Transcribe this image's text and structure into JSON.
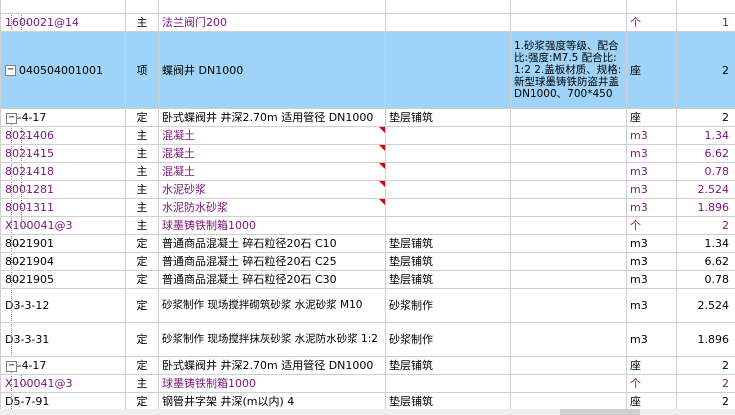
{
  "rows": [
    {
      "code": "1600021@14",
      "type": "主",
      "name": "法兰阀门200",
      "feature": "",
      "unit": "个",
      "qty": "1",
      "kind": "mat"
    },
    {
      "code": "040504001001",
      "type": "项",
      "name": "蝶阀井 DN1000",
      "feature": "1.砂浆强度等级、配合比:强度:M7.5 配合比:1:2 2.盖板材质、规格:新型球墨铸铁防盗井盖DN1000、700*450",
      "unit": "座",
      "qty": "2",
      "kind": "sel"
    },
    {
      "code": "D-4-17",
      "type": "定",
      "name": "卧式蝶阀井 井深2.70m 适用管径 DN1000",
      "feature": "垫层铺筑",
      "unit": "座",
      "qty": "2",
      "kind": "def"
    },
    {
      "code": "8021406",
      "type": "主",
      "name": "混凝土",
      "feature": "",
      "unit": "m3",
      "qty": "1.34",
      "kind": "mat",
      "flag": true
    },
    {
      "code": "8021415",
      "type": "主",
      "name": "混凝土",
      "feature": "",
      "unit": "m3",
      "qty": "6.62",
      "kind": "mat",
      "flag": true
    },
    {
      "code": "8021418",
      "type": "主",
      "name": "混凝土",
      "feature": "",
      "unit": "m3",
      "qty": "0.78",
      "kind": "mat",
      "flag": true
    },
    {
      "code": "8001281",
      "type": "主",
      "name": "水泥砂浆",
      "feature": "",
      "unit": "m3",
      "qty": "2.524",
      "kind": "mat",
      "flag": true
    },
    {
      "code": "8001311",
      "type": "主",
      "name": "水泥防水砂浆",
      "feature": "",
      "unit": "m3",
      "qty": "1.896",
      "kind": "mat",
      "flag": true
    },
    {
      "code": "X100041@3",
      "type": "主",
      "name": "球墨铸铁制箱1000",
      "feature": "",
      "unit": "个",
      "qty": "2",
      "kind": "mat"
    },
    {
      "code": "8021901",
      "type": "定",
      "name": "普通商品混凝土 碎石粒径20石 C10",
      "feature": "垫层铺筑",
      "unit": "m3",
      "qty": "1.34",
      "kind": "def"
    },
    {
      "code": "8021904",
      "type": "定",
      "name": "普通商品混凝土 碎石粒径20石 C25",
      "feature": "垫层铺筑",
      "unit": "m3",
      "qty": "6.62",
      "kind": "def"
    },
    {
      "code": "8021905",
      "type": "定",
      "name": "普通商品混凝土 碎石粒径20石 C30",
      "feature": "垫层铺筑",
      "unit": "m3",
      "qty": "0.78",
      "kind": "def"
    },
    {
      "code": "D3-3-12",
      "type": "定",
      "name": "砂浆制作 现场搅拌砌筑砂浆 水泥砂浆 M10",
      "feature": "砂浆制作",
      "unit": "m3",
      "qty": "2.524",
      "kind": "def",
      "tall": true
    },
    {
      "code": "D3-3-31",
      "type": "定",
      "name": "砂浆制作 现场搅拌抹灰砂浆 水泥防水砂浆 1:2",
      "feature": "砂浆制作",
      "unit": "m3",
      "qty": "1.896",
      "kind": "def",
      "tall": true
    },
    {
      "code": "D-4-17",
      "type": "定",
      "name": "卧式蝶阀井 井深2.70m 适用管径 DN1000",
      "feature": "垫层铺筑",
      "unit": "座",
      "qty": "2",
      "kind": "def"
    },
    {
      "code": "X100041@3",
      "type": "主",
      "name": "球墨铸铁制箱1000",
      "feature": "",
      "unit": "个",
      "qty": "2",
      "kind": "mat"
    },
    {
      "code": "D5-7-91",
      "type": "定",
      "name": "钢管井字架 井深(m以内) 4",
      "feature": "垫层铺筑",
      "unit": "座",
      "qty": "2",
      "kind": "def"
    }
  ]
}
